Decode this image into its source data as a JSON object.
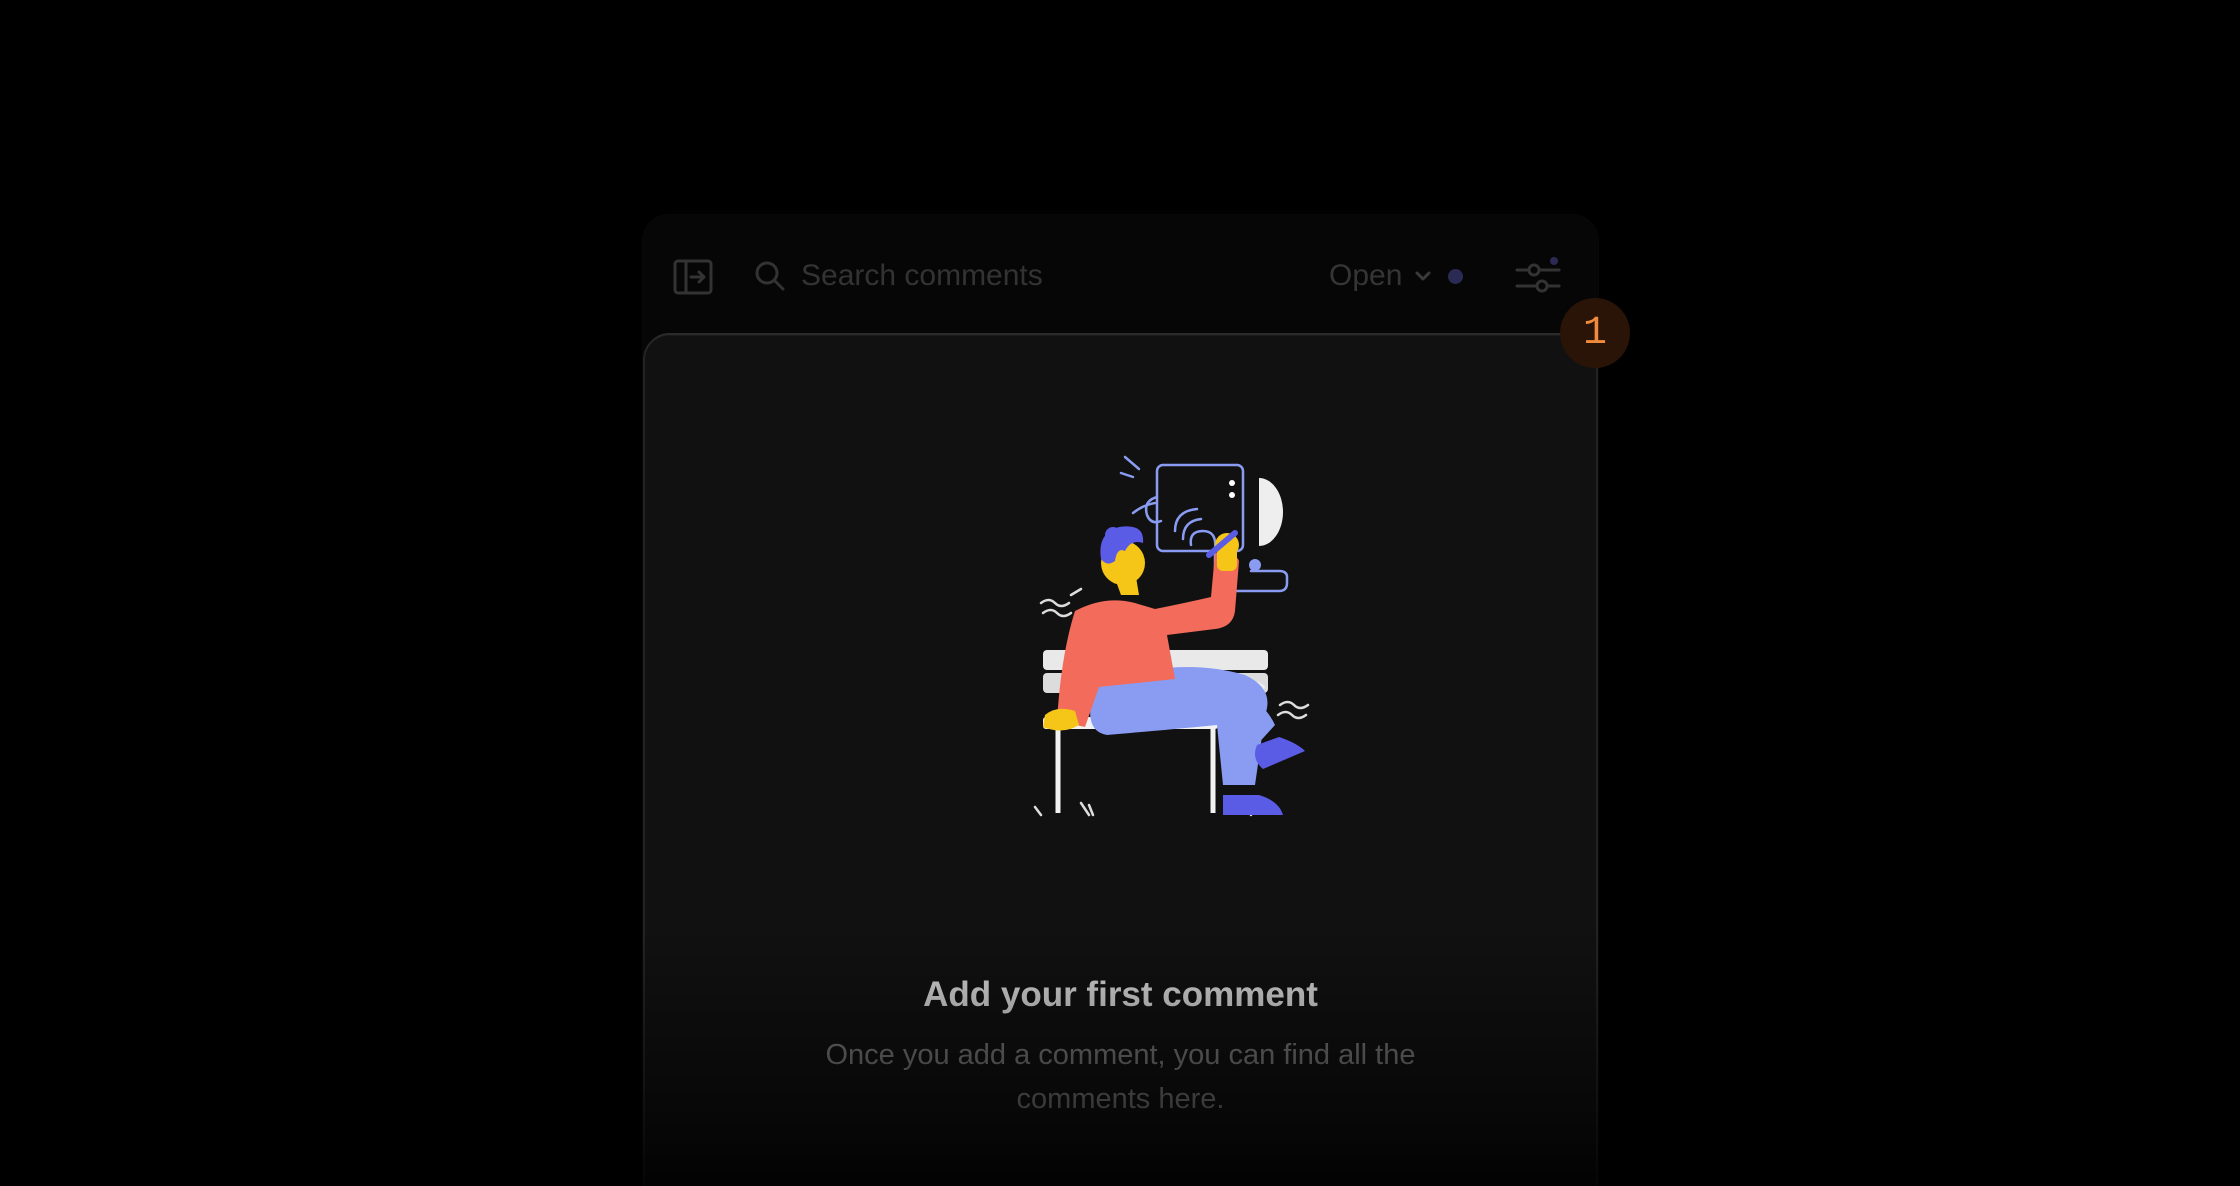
{
  "toolbar": {
    "search_placeholder": "Search comments",
    "status_value": "Open",
    "sidebar_toggle_icon": "sidebar-collapse-icon",
    "filter_icon": "sliders-icon"
  },
  "notification_badge": {
    "count": "1",
    "color": "#f08a3c"
  },
  "empty_state": {
    "title": "Add your first comment",
    "description": "Once you add a comment, you can find all the comments here."
  },
  "colors": {
    "background": "#000000",
    "panel": "#111111",
    "accent_orange": "#f08a3c",
    "status_dot": "#2b2a55"
  }
}
